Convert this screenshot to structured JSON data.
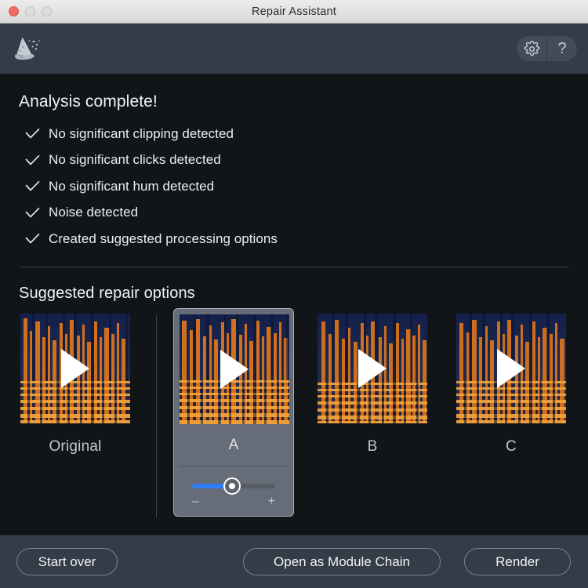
{
  "window": {
    "title": "Repair Assistant",
    "traffic_lights": [
      "close",
      "minimize",
      "maximize"
    ],
    "close_color": "#f26a61"
  },
  "header": {
    "logo_icon": "wizard-hat-icon",
    "settings_icon": "gear-icon",
    "help_label": "?",
    "help_icon": "question-mark-icon",
    "background_color": "#343c48"
  },
  "analysis": {
    "heading": "Analysis complete!",
    "items": [
      {
        "icon": "check-icon",
        "label": "No significant clipping detected"
      },
      {
        "icon": "check-icon",
        "label": "No significant clicks detected"
      },
      {
        "icon": "check-icon",
        "label": "No significant hum detected"
      },
      {
        "icon": "check-icon",
        "label": "Noise detected"
      },
      {
        "icon": "check-icon",
        "label": "Created suggested processing options"
      }
    ]
  },
  "suggestions": {
    "heading": "Suggested repair options",
    "cards": [
      {
        "label": "Original",
        "selected": false,
        "play_icon": "play-icon"
      },
      {
        "label": "A",
        "selected": true,
        "play_icon": "play-icon"
      },
      {
        "label": "B",
        "selected": false,
        "play_icon": "play-icon"
      },
      {
        "label": "C",
        "selected": false,
        "play_icon": "play-icon"
      }
    ],
    "slider": {
      "value_percent": 42,
      "decrease_label": "–",
      "increase_label": "+",
      "fill_color": "#2f7df6"
    }
  },
  "footer": {
    "start_over_label": "Start over",
    "open_module_chain_label": "Open as Module Chain",
    "render_label": "Render"
  }
}
